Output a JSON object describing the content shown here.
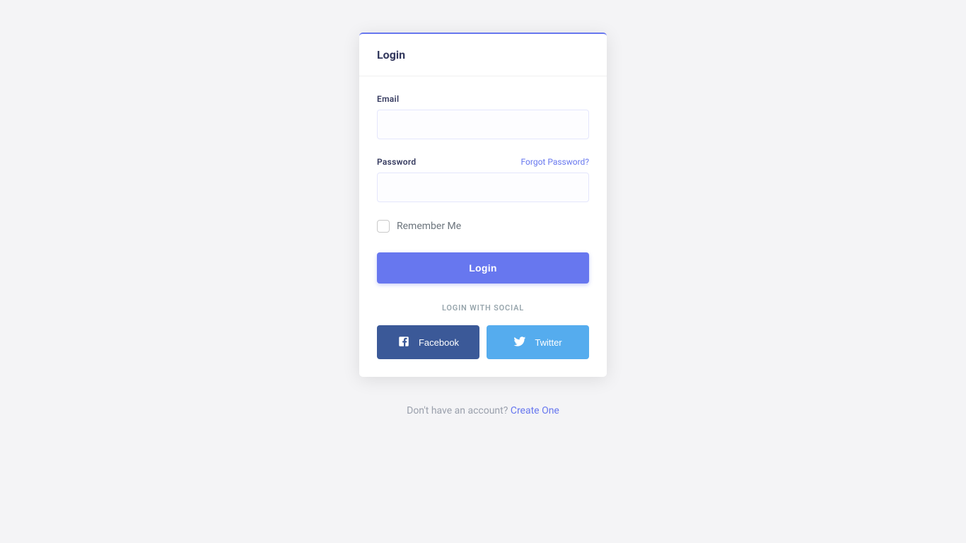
{
  "header": {
    "title": "Login"
  },
  "form": {
    "email_label": "Email",
    "password_label": "Password",
    "forgot_link": "Forgot Password?",
    "remember_label": "Remember Me",
    "submit_label": "Login"
  },
  "social": {
    "title": "Login With Social",
    "facebook_label": "Facebook",
    "twitter_label": "Twitter"
  },
  "footer": {
    "prompt": "Don't have an account? ",
    "link_label": "Create One"
  }
}
